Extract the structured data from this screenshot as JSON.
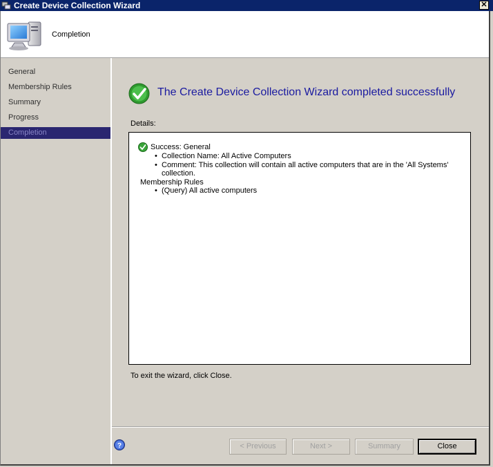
{
  "window": {
    "title": "Create Device Collection Wizard",
    "close_glyph": "✕"
  },
  "header": {
    "title": "Completion",
    "icon": "computer-icon"
  },
  "nav": {
    "items": [
      {
        "label": "General"
      },
      {
        "label": "Membership Rules"
      },
      {
        "label": "Summary"
      },
      {
        "label": "Progress"
      },
      {
        "label": "Completion",
        "active": true
      }
    ]
  },
  "main": {
    "heading": "The Create Device Collection Wizard completed successfully",
    "details_label": "Details:",
    "details": {
      "status": "Success: General",
      "general_items": [
        "Collection Name: All Active Computers",
        "Comment: This collection will contain all active computers that are in the 'All Systems' collection."
      ],
      "section_title": "Membership Rules",
      "rule_items": [
        "(Query) All active computers"
      ]
    },
    "exit_text": "To exit the wizard, click Close."
  },
  "footer": {
    "previous_label": "< Previous",
    "next_label": "Next >",
    "summary_label": "Summary",
    "close_label": "Close"
  },
  "colors": {
    "title_bar": "#0a246a",
    "heading_text": "#1a1aa0",
    "active_nav": "#2a2670",
    "success_green": "#3aa53a"
  }
}
